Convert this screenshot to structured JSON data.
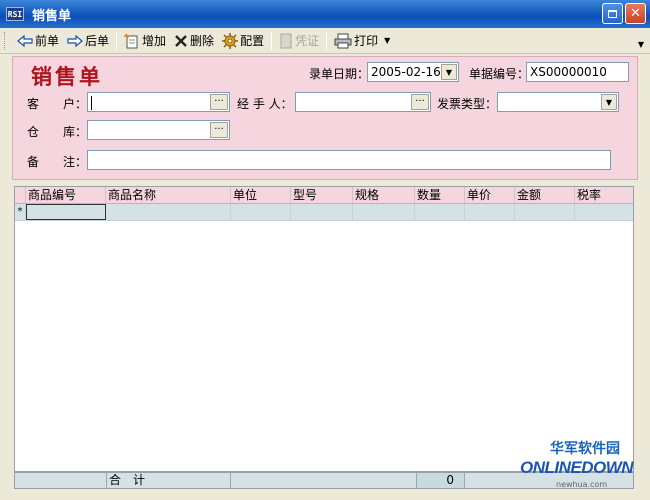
{
  "window": {
    "title": "销售单",
    "icon_text": "RSI"
  },
  "toolbar": {
    "prev_label": "前单",
    "next_label": "后单",
    "add_label": "增加",
    "delete_label": "删除",
    "config_label": "配置",
    "voucher_label": "凭证",
    "print_label": "打印"
  },
  "form": {
    "title": "销售单",
    "date_label": "录单日期：",
    "date_value": "2005-02-16",
    "docno_label": "单据编号：",
    "docno_value": "XS00000010",
    "customer_label": "客　　户：",
    "customer_value": "",
    "handler_label": "经 手 人：",
    "handler_value": "",
    "invoice_label": "发票类型：",
    "invoice_value": "",
    "warehouse_label": "仓　　库：",
    "warehouse_value": "",
    "remark_label": "备　　注：",
    "remark_value": ""
  },
  "grid": {
    "columns": [
      "商品编号",
      "商品名称",
      "单位",
      "型号",
      "规格",
      "数量",
      "单价",
      "金额",
      "税率"
    ],
    "new_row_marker": "*"
  },
  "footer": {
    "total_label": "合　计",
    "quantity_total": "0"
  },
  "watermark": {
    "cn": "华军软件园",
    "logo": "ONLINEDOWN",
    "url": "newhua.com"
  }
}
